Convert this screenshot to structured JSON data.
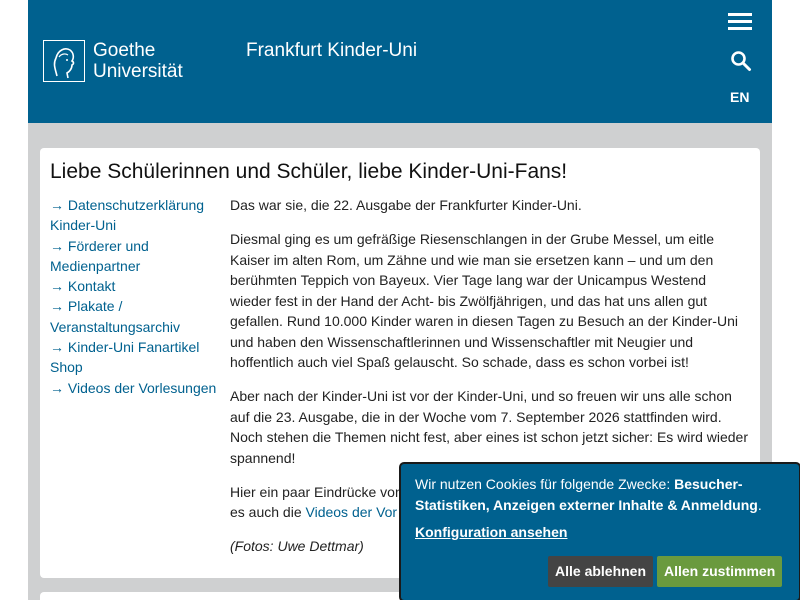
{
  "header": {
    "logo_line1": "Goethe",
    "logo_line2": "Universität",
    "site_title": "Frankfurt Kinder-Uni",
    "lang": "EN",
    "icons": {
      "menu": "hamburger-menu-icon",
      "search": "search-icon",
      "logo": "goethe-portrait-icon"
    }
  },
  "page": {
    "title": "Liebe Schülerinnen und Schüler, liebe Kinder-Uni-Fans!"
  },
  "sidenav": {
    "items": [
      {
        "label": "→ Datenschutzerklärung Kinder-Uni"
      },
      {
        "label": "→ Förderer und Medienpartner"
      },
      {
        "label": "→ Kontakt"
      },
      {
        "label": "→ Plakate / Veranstaltungsarchiv"
      },
      {
        "label": "→ Kinder-Uni Fanartikel Shop"
      },
      {
        "label": "→ Videos der Vorlesungen"
      }
    ]
  },
  "content": {
    "p1": "Das war sie, die 22. Ausgabe der Frankfurter Kinder-Uni.",
    "p2": "Diesmal ging es um gefräßige Riesenschlangen in der Grube Messel, um eitle Kaiser im alten Rom, um Zähne und wie man sie ersetzen kann – und um den berühmten Teppich von Bayeux. Vier Tage lang war der Unicampus Westend wieder fest in der Hand der Acht- bis Zwölfjährigen, und das hat uns allen gut gefallen. Rund 10.000 Kinder waren in diesen Tagen zu Besuch an der Kinder-Uni und haben den Wissenschaftlerinnen und Wissenschaftler mit Neugier und hoffentlich auch viel Spaß gelauscht. So schade, dass es schon vorbei ist!",
    "p3": "Aber nach der Kinder-Uni ist vor der Kinder-Uni, und so freuen wir uns alle schon auf die 23. Ausgabe, die in der Woche vom 7. September 2026 stattfinden wird. Noch stehen die Themen nicht fest, aber eines ist schon jetzt sicher: Es wird wieder spannend!",
    "p4_start": "Hier ein paar Eindrücke von",
    "p4_mid": "es auch die ",
    "p4_link": "Videos der Vor",
    "credit": "(Fotos: Uwe Dettmar)"
  },
  "cookie": {
    "text_intro": "Wir nutzen Cookies für folgende Zwecke: ",
    "text_bold": "Besucher-Statistiken, Anzeigen externer Inhalte & Anmeldung",
    "text_end": ".",
    "config_link": "Konfiguration ansehen",
    "decline": "Alle ablehnen",
    "accept": "Allen zustimmen",
    "colors": {
      "decline_bg": "#444444",
      "accept_bg": "#6a9a3e",
      "banner_bg": "#00618f"
    }
  },
  "colors": {
    "brand": "#00618f",
    "page_bg": "#cfd0d1"
  }
}
